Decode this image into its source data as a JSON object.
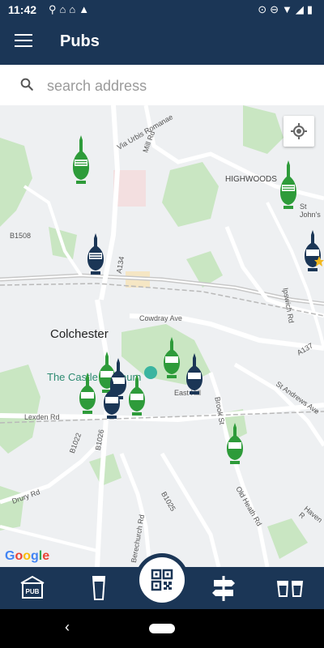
{
  "status": {
    "time": "11:42"
  },
  "app_bar": {
    "title": "Pubs"
  },
  "search": {
    "placeholder": "search address"
  },
  "map": {
    "labels": {
      "colchester": "Colchester",
      "castle_museum": "The Castle Museum",
      "highwoods": "HIGHWOODS",
      "cowdray_ave": "Cowdray Ave",
      "east_hill": "East Hill",
      "lexden_rd": "Lexden Rd",
      "drury_rd": "Drury Rd",
      "mill_rd": "Mill Rd",
      "b1508": "B1508",
      "a134": "A134",
      "b1022": "B1022",
      "b1026": "B1026",
      "b1025": "B1025",
      "a137": "A137",
      "brook_st": "Brook St",
      "ipswich_rd": "Ipswich Rd",
      "st_andrews_ave": "St Andrews Ave",
      "old_heath_rd": "Old Heath Rd",
      "haven_rd": "Haven R",
      "st_johns": "St John's",
      "berechurch_rd": "Berechurch Rd",
      "via_urbis": "Via Urbis Romanae"
    },
    "marker_text": "CASK MARQUE",
    "google_logo": [
      "G",
      "o",
      "o",
      "g",
      "l",
      "e"
    ]
  },
  "colors": {
    "primary": "#1b3656",
    "marker_green": "#2e9b3a",
    "marker_navy": "#1b3656",
    "park": "#c9e6c2"
  },
  "bottom_nav": {
    "pub_label": "PUB"
  }
}
